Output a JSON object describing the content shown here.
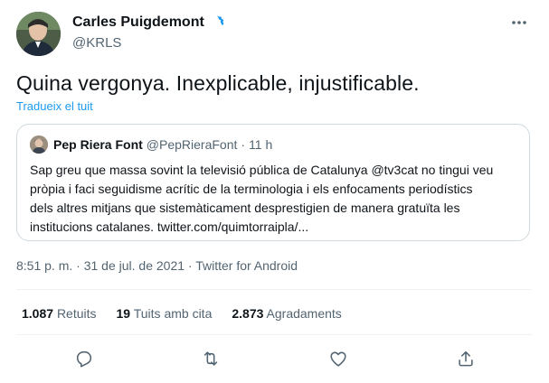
{
  "author": {
    "name": "Carles Puigdemont",
    "handle": "@KRLS",
    "avatar_icon": "avatar-photo",
    "verified_icon": "verified-badge-icon"
  },
  "tweet": {
    "text": "Quina vergonya. Inexplicable, injustificable.",
    "translate_label": "Tradueix el tuit"
  },
  "quoted_tweet": {
    "name": "Pep Riera Font",
    "handle": "@PepRieraFont",
    "separator": "·",
    "time": "11 h",
    "lines": [
      "Sap greu que massa sovint la televisió pública de Catalunya @tv3cat no tingui veu",
      "pròpia i faci seguidisme acrític de la terminologia i els enfocaments periodístics",
      "dels altres mitjans que sistemàticament desprestigien de manera gratuïta les",
      "institucions catalanes. twitter.com/quimtorraipla/..."
    ]
  },
  "meta": {
    "timestamp": "8:51 p. m. · 31 de jul. de 2021 · Twitter for Android"
  },
  "stats": {
    "retweets": {
      "value": "1.087",
      "label": "Retuits"
    },
    "quotes": {
      "value": "19",
      "label": "Tuits amb cita"
    },
    "likes": {
      "value": "2.873",
      "label": "Agradaments"
    }
  },
  "actions": [
    "reply-icon",
    "retweet-icon",
    "like-icon",
    "share-icon"
  ],
  "colors": {
    "accent": "#1d9bf0",
    "text": "#0f1419",
    "secondary": "#536471",
    "border": "#cfd9de"
  }
}
